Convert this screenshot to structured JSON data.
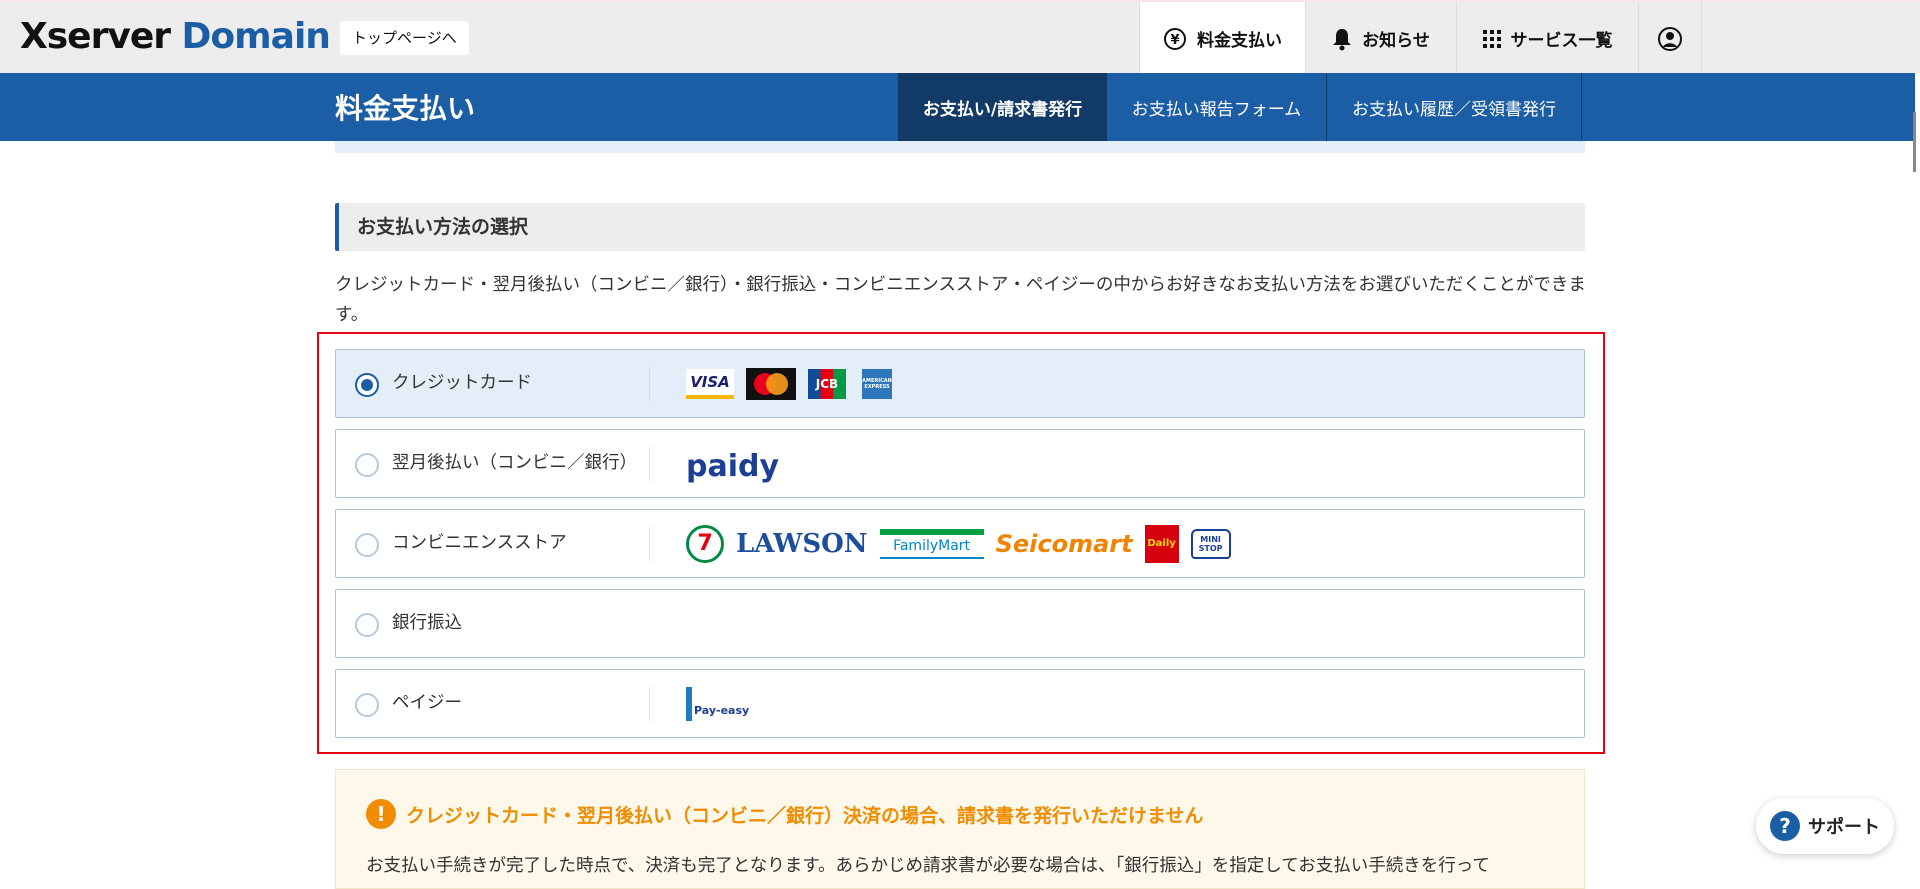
{
  "header": {
    "logo_part1": "Xserver",
    "logo_part2": "Domain",
    "top_link": "トップページへ",
    "nav": [
      {
        "label": "料金支払い",
        "icon": "yen-icon"
      },
      {
        "label": "お知らせ",
        "icon": "bell-icon"
      },
      {
        "label": "サービス一覧",
        "icon": "grid-icon"
      },
      {
        "label": "",
        "icon": "user-icon"
      }
    ]
  },
  "subnav": {
    "title": "料金支払い",
    "tabs": [
      {
        "label": "お支払い/請求書発行",
        "active": true
      },
      {
        "label": "お支払い報告フォーム"
      },
      {
        "label": "お支払い履歴／受領書発行"
      }
    ]
  },
  "section": {
    "heading": "お支払い方法の選択",
    "description": "クレジットカード・翌月後払い（コンビニ／銀行）・銀行振込・コンビニエンスストア・ペイジーの中からお好きなお支払い方法をお選びいただくことができます。"
  },
  "options": [
    {
      "label": "クレジットカード",
      "selected": true,
      "logos": [
        "VISA",
        "Mastercard",
        "JCB",
        "AMERICAN EXPRESS"
      ]
    },
    {
      "label": "翌月後払い（コンビニ／銀行）",
      "selected": false,
      "logos": [
        "paidy"
      ]
    },
    {
      "label": "コンビニエンスストア",
      "selected": false,
      "logos": [
        "7-ELEVEN",
        "LAWSON",
        "FamilyMart",
        "Seicomart",
        "Daily",
        "MINI STOP"
      ]
    },
    {
      "label": "銀行振込",
      "selected": false,
      "logos": []
    },
    {
      "label": "ペイジー",
      "selected": false,
      "logos": [
        "Pay-easy"
      ]
    }
  ],
  "warning": {
    "title": "クレジットカード・翌月後払い（コンビニ／銀行）決済の場合、請求書を発行いただけません",
    "text": "お支払い手続きが完了した時点で、決済も完了となります。あらかじめ請求書が必要な場合は、「銀行振込」を指定してお支払い手続きを行って"
  },
  "support": {
    "label": "サポート"
  },
  "colors": {
    "brand": "#1c5ea5",
    "highlight": "#e60012",
    "warning": "#f08c00"
  }
}
